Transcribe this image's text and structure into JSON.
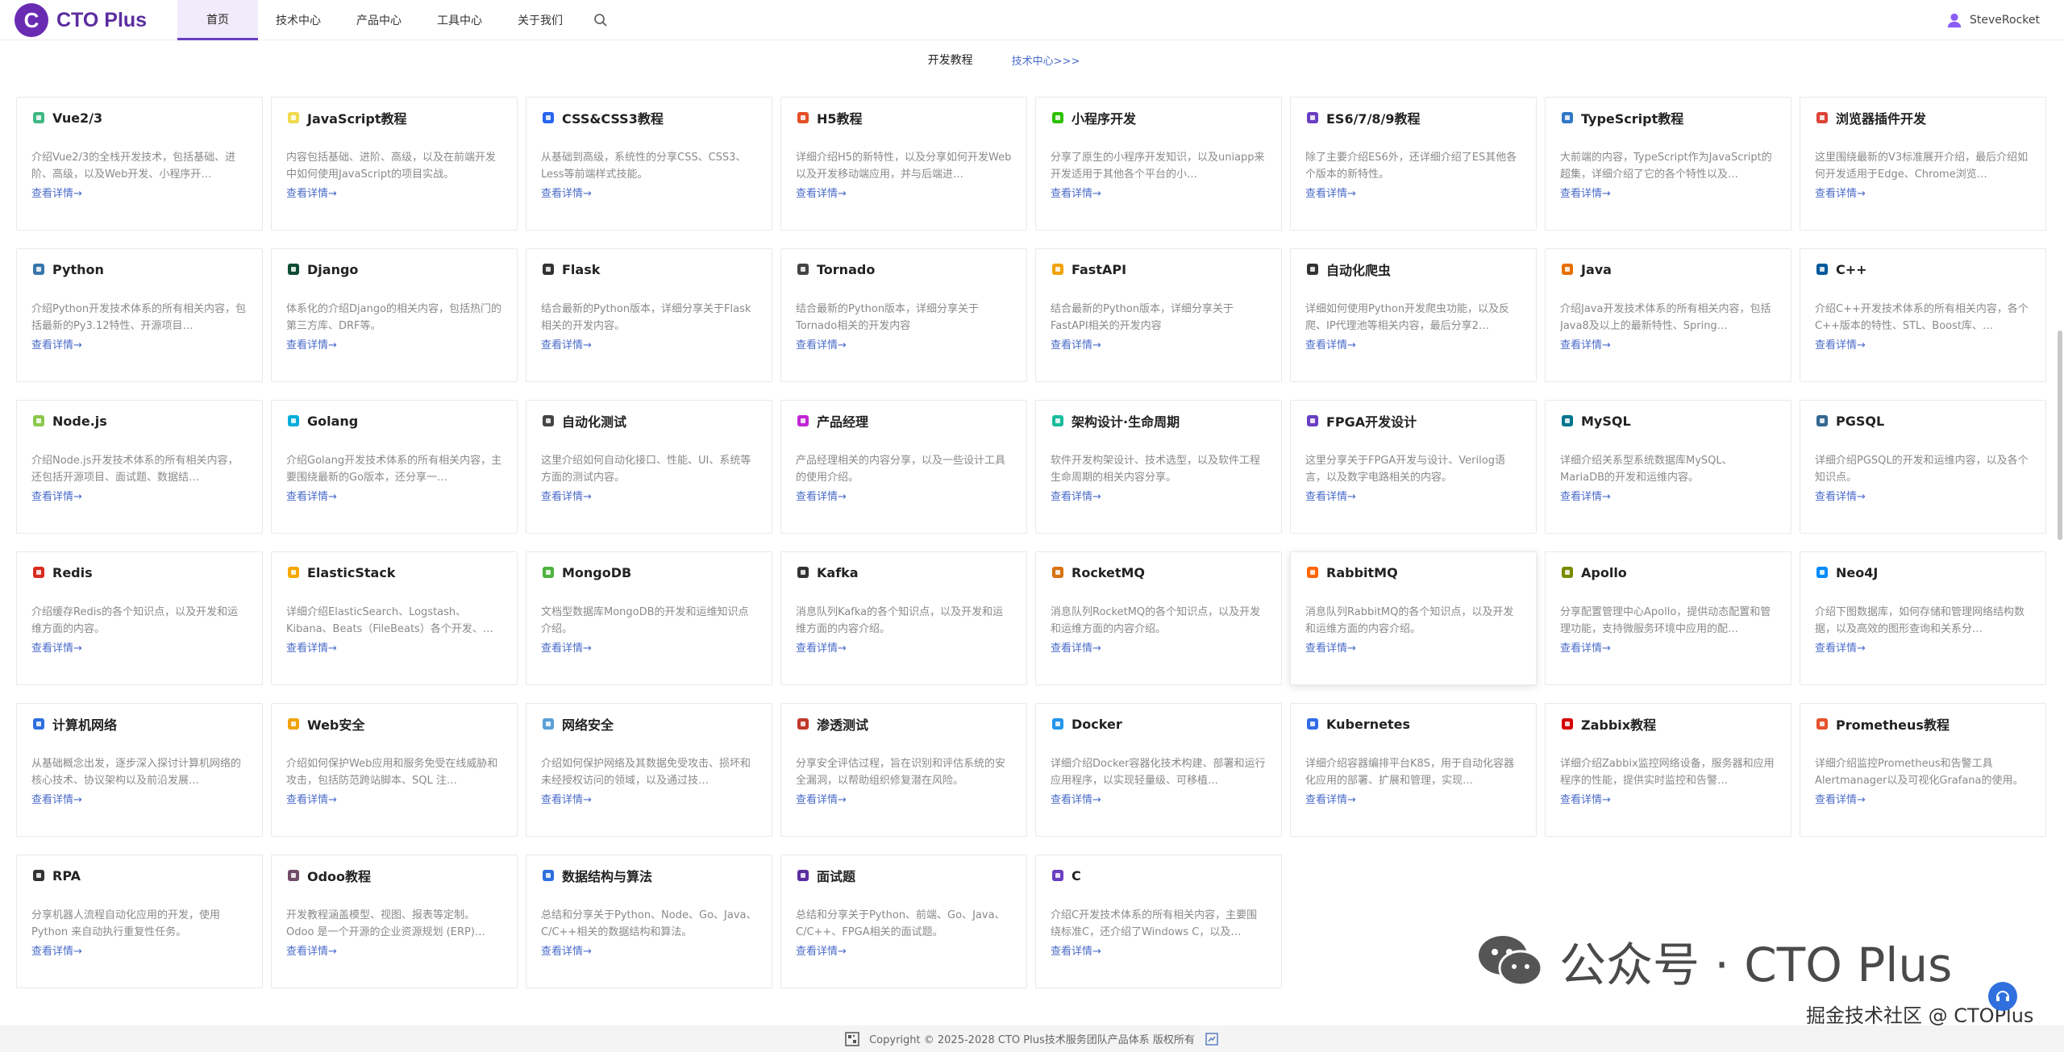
{
  "header": {
    "logo_letter": "C",
    "logo_text": "CTO Plus",
    "nav": [
      {
        "label": "首页",
        "active": true
      },
      {
        "label": "技术中心",
        "active": false
      },
      {
        "label": "产品中心",
        "active": false
      },
      {
        "label": "工具中心",
        "active": false
      },
      {
        "label": "关于我们",
        "active": false
      }
    ],
    "user_name": "SteveRocket"
  },
  "subbar": {
    "title": "开发教程",
    "link": "技术中心>>>"
  },
  "more_label": "查看详情→",
  "cards": [
    {
      "title": "Vue2/3",
      "icon": "vue-icon",
      "color": "#41b883",
      "desc": "介绍Vue2/3的全栈开发技术，包括基础、进阶、高级，以及Web开发、小程序开…"
    },
    {
      "title": "JavaScript教程",
      "icon": "javascript-icon",
      "color": "#f0db4f",
      "desc": "内容包括基础、进阶、高级，以及在前端开发中如何使用JavaScript的项目实战。"
    },
    {
      "title": "CSS&CSS3教程",
      "icon": "css-icon",
      "color": "#2965f1",
      "desc": "从基础到高级，系统性的分享CSS、CSS3、Less等前端样式技能。"
    },
    {
      "title": "H5教程",
      "icon": "html5-icon",
      "color": "#e34f26",
      "desc": "详细介绍H5的新特性，以及分享如何开发Web以及开发移动端应用，并与后端进…"
    },
    {
      "title": "小程序开发",
      "icon": "wechat-icon",
      "color": "#2dc100",
      "desc": "分享了原生的小程序开发知识，以及uniapp来开发适用于其他各个平台的小…"
    },
    {
      "title": "ES6/7/8/9教程",
      "icon": "es6-icon",
      "color": "#6a3fc2",
      "desc": "除了主要介绍ES6外，还详细介绍了ES其他各个版本的新特性。"
    },
    {
      "title": "TypeScript教程",
      "icon": "typescript-icon",
      "color": "#3178c6",
      "desc": "大前端的内容，TypeScript作为JavaScript的超集，详细介绍了它的各个特性以及…"
    },
    {
      "title": "浏览器插件开发",
      "icon": "chrome-icon",
      "color": "#db4437",
      "desc": "这里围绕最新的V3标准展开介绍，最后介绍如何开发适用于Edge、Chrome浏览…"
    },
    {
      "title": "Python",
      "icon": "python-icon",
      "color": "#3776ab",
      "desc": "介绍Python开发技术体系的所有相关内容，包括最新的Py3.12特性、开源项目…"
    },
    {
      "title": "Django",
      "icon": "django-icon",
      "color": "#0c4b33",
      "desc": "体系化的介绍Django的相关内容，包括热门的第三方库、DRF等。"
    },
    {
      "title": "Flask",
      "icon": "flask-icon",
      "color": "#333333",
      "desc": "结合最新的Python版本，详细分享关于Flask相关的开发内容。"
    },
    {
      "title": "Tornado",
      "icon": "tornado-icon",
      "color": "#444444",
      "desc": "结合最新的Python版本，详细分享关于Tornado相关的开发内容"
    },
    {
      "title": "FastAPI",
      "icon": "fastapi-icon",
      "color": "#f0a30a",
      "desc": "结合最新的Python版本，详细分享关于FastAPI相关的开发内容"
    },
    {
      "title": "自动化爬虫",
      "icon": "spider-icon",
      "color": "#333333",
      "desc": "详细如何使用Python开发爬虫功能，以及反爬、IP代理池等相关内容，最后分享2…"
    },
    {
      "title": "Java",
      "icon": "java-icon",
      "color": "#e76f00",
      "desc": "介绍Java开发技术体系的所有相关内容，包括Java8及以上的最新特性、Spring…"
    },
    {
      "title": "C++",
      "icon": "cpp-icon",
      "color": "#00599c",
      "desc": "介绍C++开发技术体系的所有相关内容，各个C++版本的特性、STL、Boost库、…"
    },
    {
      "title": "Node.js",
      "icon": "nodejs-icon",
      "color": "#8cc84b",
      "desc": "介绍Node.js开发技术体系的所有相关内容，还包括开源项目、面试题、数据结…"
    },
    {
      "title": "Golang",
      "icon": "golang-icon",
      "color": "#00add8",
      "desc": "介绍Golang开发技术体系的所有相关内容，主要围绕最新的Go版本，还分享一…"
    },
    {
      "title": "自动化测试",
      "icon": "gear-icon",
      "color": "#444444",
      "desc": "这里介绍如何自动化接口、性能、UI、系统等方面的测试内容。"
    },
    {
      "title": "产品经理",
      "icon": "cube-icon",
      "color": "#c026d3",
      "desc": "产品经理相关的内容分享，以及一些设计工具的使用介绍。"
    },
    {
      "title": "架构设计·生命周期",
      "icon": "architecture-icon",
      "color": "#1abc9c",
      "desc": "软件开发构架设计、技术选型，以及软件工程生命周期的相关内容分享。"
    },
    {
      "title": "FPGA开发设计",
      "icon": "chip-icon",
      "color": "#6a3fc2",
      "desc": "这里分享关于FPGA开发与设计、Verilog语言，以及数字电路相关的内容。"
    },
    {
      "title": "MySQL",
      "icon": "mysql-icon",
      "color": "#00758f",
      "desc": "详细介绍关系型系统数据库MySQL、MariaDB的开发和运维内容。"
    },
    {
      "title": "PGSQL",
      "icon": "postgresql-icon",
      "color": "#336791",
      "desc": "详细介绍PGSQL的开发和运维内容，以及各个知识点。"
    },
    {
      "title": "Redis",
      "icon": "redis-icon",
      "color": "#d82c20",
      "desc": "介绍缓存Redis的各个知识点，以及开发和运维方面的内容。"
    },
    {
      "title": "ElasticStack",
      "icon": "elastic-icon",
      "color": "#f5a800",
      "desc": "详细介绍ElasticSearch、Logstash、Kibana、Beats（FileBeats）各个开发、…"
    },
    {
      "title": "MongoDB",
      "icon": "mongodb-icon",
      "color": "#4db33d",
      "desc": "文档型数据库MongoDB的开发和运维知识点介绍。"
    },
    {
      "title": "Kafka",
      "icon": "kafka-icon",
      "color": "#333333",
      "desc": "消息队列Kafka的各个知识点，以及开发和运维方面的内容介绍。"
    },
    {
      "title": "RocketMQ",
      "icon": "rocketmq-icon",
      "color": "#d77310",
      "desc": "消息队列RocketMQ的各个知识点，以及开发和运维方面的内容介绍。"
    },
    {
      "title": "RabbitMQ",
      "icon": "rabbitmq-icon",
      "color": "#ff6600",
      "desc": "消息队列RabbitMQ的各个知识点，以及开发和运维方面的内容介绍。"
    },
    {
      "title": "Apollo",
      "icon": "apollo-icon",
      "color": "#7a8b00",
      "desc": "分享配置管理中心Apollo，提供动态配置和管理功能，支持微服务环境中应用的配…"
    },
    {
      "title": "Neo4J",
      "icon": "neo4j-icon",
      "color": "#018bff",
      "desc": "介绍下图数据库，如何存储和管理网络结构数据，以及高效的图形查询和关系分…"
    },
    {
      "title": "计算机网络",
      "icon": "globe-icon",
      "color": "#2f6fde",
      "desc": "从基础概念出发，逐步深入探讨计算机网络的核心技术、协议架构以及前沿发展…"
    },
    {
      "title": "Web安全",
      "icon": "shield-icon",
      "color": "#f0a30a",
      "desc": "介绍如何保护Web应用和服务免受在线威胁和攻击，包括防范跨站脚本、SQL 注…"
    },
    {
      "title": "网络安全",
      "icon": "network-security-icon",
      "color": "#5aa0d6",
      "desc": "介绍如何保护网络及其数据免受攻击、损坏和未经授权访问的领域，以及通过技…"
    },
    {
      "title": "渗透测试",
      "icon": "pentest-icon",
      "color": "#c0392b",
      "desc": "分享安全评估过程，旨在识别和评估系统的安全漏洞，以帮助组织修复潜在风险。"
    },
    {
      "title": "Docker",
      "icon": "docker-icon",
      "color": "#2496ed",
      "desc": "详细介绍Docker容器化技术构建、部署和运行应用程序，以实现轻量级、可移植…"
    },
    {
      "title": "Kubernetes",
      "icon": "kubernetes-icon",
      "color": "#326ce5",
      "desc": "详细介绍容器编排平台K8S，用于自动化容器化应用的部署、扩展和管理，实现…"
    },
    {
      "title": "Zabbix教程",
      "icon": "zabbix-icon",
      "color": "#d40000",
      "desc": "详细介绍Zabbix监控网络设备，服务器和应用程序的性能，提供实时监控和告警…"
    },
    {
      "title": "Prometheus教程",
      "icon": "prometheus-icon",
      "color": "#e6522c",
      "desc": "详细介绍监控Prometheus和告警工具Alertmanager以及可视化Grafana的使用。"
    },
    {
      "title": "RPA",
      "icon": "rpa-icon",
      "color": "#333333",
      "desc": "分享机器人流程自动化应用的开发，使用Python 来自动执行重复性任务。"
    },
    {
      "title": "Odoo教程",
      "icon": "odoo-icon",
      "color": "#714b67",
      "desc": "开发教程涵盖模型、视图、报表等定制。Odoo 是一个开源的企业资源规划 (ERP)…"
    },
    {
      "title": "数据结构与算法",
      "icon": "algorithm-icon",
      "color": "#2f6fde",
      "desc": "总结和分享关于Python、Node、Go、Java、C/C++相关的数据结构和算法。"
    },
    {
      "title": "面试题",
      "icon": "layers-icon",
      "color": "#5b2da0",
      "desc": "总结和分享关于Python、前端、Go、Java、C/C++、FPGA相关的面试题。"
    },
    {
      "title": "C",
      "icon": "c-icon",
      "color": "#6a3fc2",
      "desc": "介绍C开发技术体系的所有相关内容，主要围绕标准C，还介绍了Windows C，以及…"
    }
  ],
  "watermark": {
    "text": "公众号 · CTO Plus",
    "sub": "掘金技术社区 @ CTOPlus"
  },
  "footer": {
    "text": "Copyright © 2025-2028 CTO Plus技术服务团队产品体系 版权所有"
  }
}
